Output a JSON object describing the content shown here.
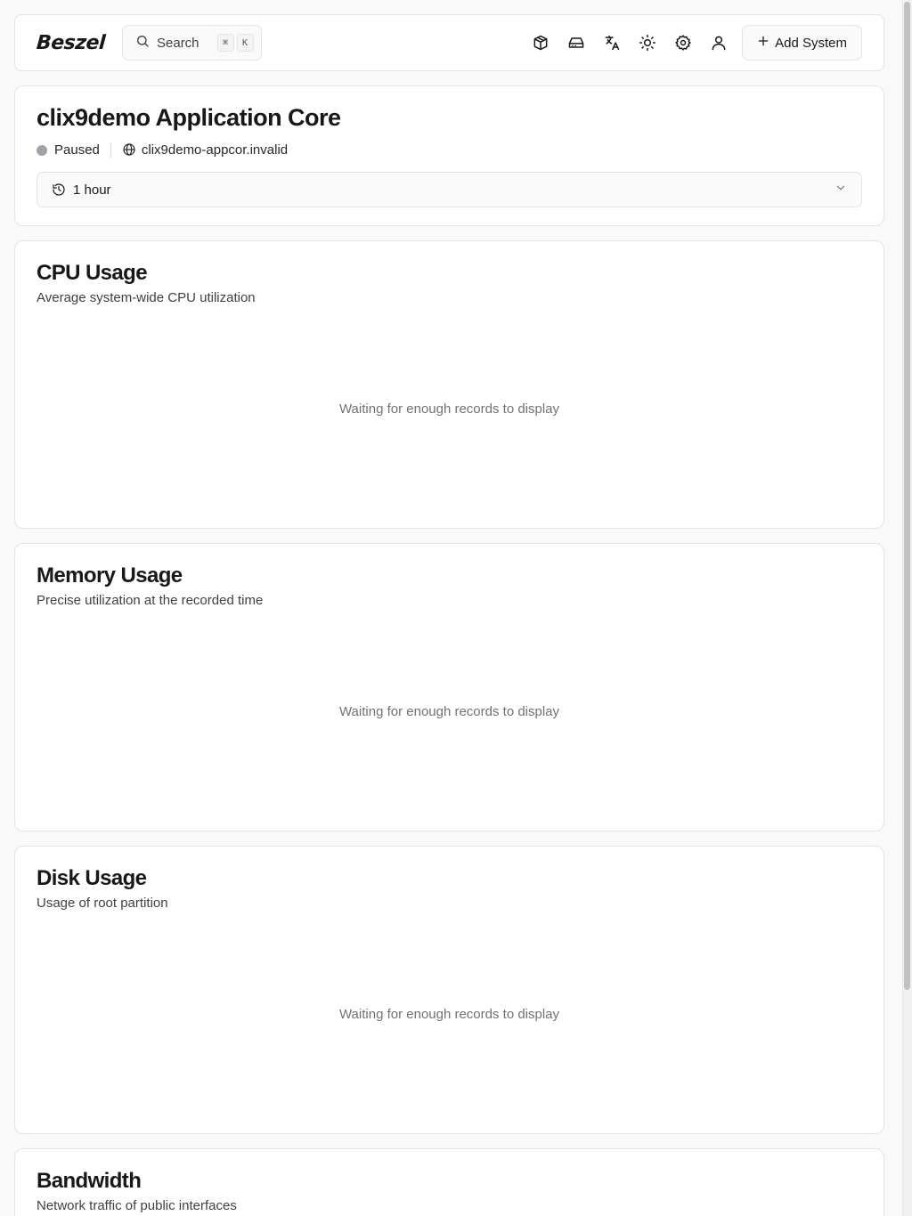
{
  "navbar": {
    "logo": "Beszel",
    "search_label": "Search",
    "kbd": [
      "⌘",
      "K"
    ],
    "icons": [
      "containers-icon",
      "drive-icon",
      "translate-icon",
      "theme-sun-icon",
      "settings-gear-icon",
      "user-icon"
    ],
    "add_system_label": "Add System"
  },
  "system": {
    "title": "clix9demo Application Core",
    "status": "Paused",
    "status_color": "#a1a1aa",
    "host": "clix9demo-appcor.invalid",
    "time_range": "1 hour"
  },
  "charts": [
    {
      "title": "CPU Usage",
      "description": "Average system-wide CPU utilization",
      "empty_text": "Waiting for enough records to display"
    },
    {
      "title": "Memory Usage",
      "description": "Precise utilization at the recorded time",
      "empty_text": "Waiting for enough records to display"
    },
    {
      "title": "Disk Usage",
      "description": "Usage of root partition",
      "empty_text": "Waiting for enough records to display"
    },
    {
      "title": "Bandwidth",
      "description": "Network traffic of public interfaces"
    }
  ]
}
